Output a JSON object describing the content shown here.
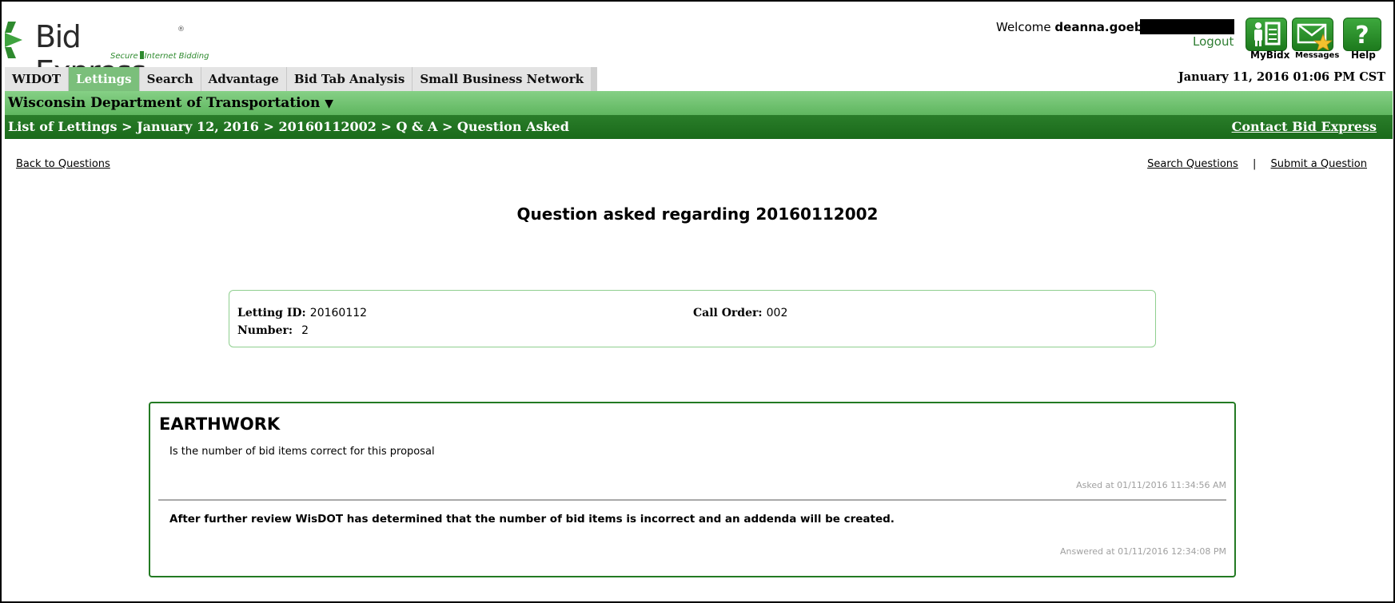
{
  "brand": {
    "name": "Bid Express",
    "registered": "®",
    "tagline_part1": "Secure",
    "tagline_part2": "Internet Bidding"
  },
  "user": {
    "welcome_prefix": "Welcome",
    "username": "deanna.goebel",
    "logout_label": "Logout"
  },
  "toolbar_icons": [
    {
      "label": "MyBidx",
      "icon": "mybidx-icon"
    },
    {
      "label": "Messages",
      "icon": "messages-envelope-icon"
    },
    {
      "label": "Help",
      "icon": "help-question-icon"
    }
  ],
  "tabs": [
    {
      "label": "WIDOT",
      "active": false
    },
    {
      "label": "Lettings",
      "active": true
    },
    {
      "label": "Search",
      "active": false
    },
    {
      "label": "Advantage",
      "active": false
    },
    {
      "label": "Bid Tab Analysis",
      "active": false
    },
    {
      "label": "Small Business Network",
      "active": false
    }
  ],
  "datetime": "January 11, 2016 01:06 PM CST",
  "department": {
    "label": "Wisconsin Department of Transportation",
    "caret": "▼"
  },
  "breadcrumb": {
    "text": "List of Lettings > January 12, 2016 > 20160112002 > Q & A > Question Asked",
    "contact_label": "Contact Bid Express"
  },
  "links": {
    "back": "Back to Questions",
    "search": "Search Questions",
    "separator": "|",
    "submit": "Submit a Question"
  },
  "page_title": "Question asked regarding 20160112002",
  "info": {
    "letting_id_label": "Letting ID:",
    "letting_id_value": "20160112",
    "number_label": "Number:",
    "number_value": "2",
    "call_order_label": "Call Order:",
    "call_order_value": "002"
  },
  "question": {
    "title": "EARTHWORK",
    "text": "Is the number of bid items correct for this proposal",
    "asked_at": "Asked at 01/11/2016 11:34:56 AM",
    "answer": "After further review WisDOT has determined that the number of bid items is incorrect and an addenda will be created.",
    "answered_at": "Answered at 01/11/2016 12:34:08 PM"
  },
  "colors": {
    "accent_green": "#2e8a2e",
    "dept_bar": "#6fc06f",
    "crumb_bar": "#1f731f",
    "active_tab": "#7bbf7b"
  }
}
